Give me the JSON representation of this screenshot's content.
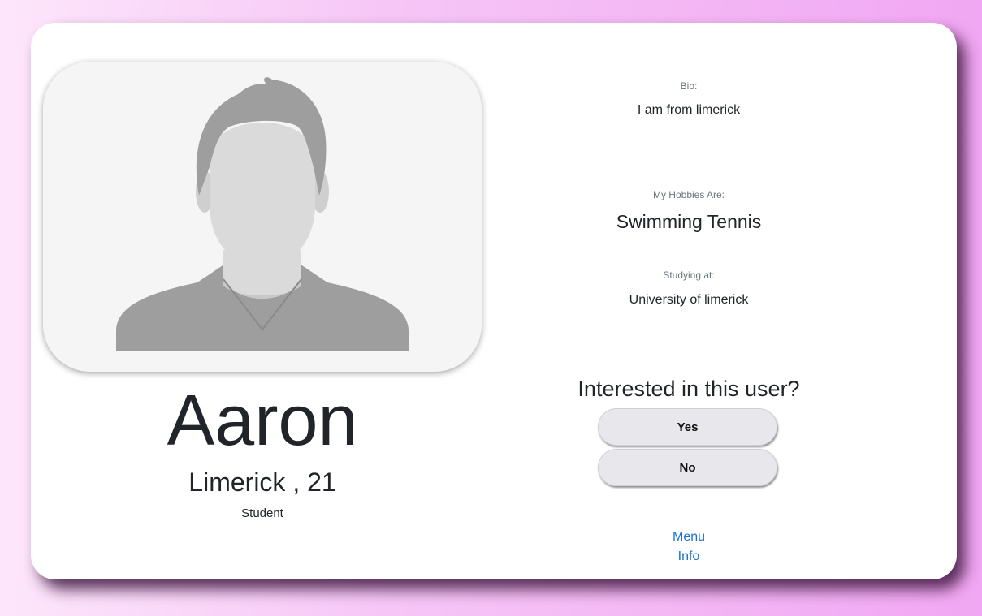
{
  "profile": {
    "name": "Aaron",
    "location_age": "Limerick , 21",
    "occupation": "Student",
    "avatar_icon": "default-user-avatar"
  },
  "details": {
    "bio_label": "Bio:",
    "bio_value": "I am from limerick",
    "hobbies_label": "My Hobbies Are:",
    "hobbies_value": "Swimming Tennis",
    "study_label": "Studying at:",
    "study_value": "University of limerick"
  },
  "interest": {
    "question": "Interested in this user?",
    "yes_label": "Yes",
    "no_label": "No"
  },
  "links": {
    "menu": "Menu",
    "info": "Info"
  },
  "colors": {
    "link": "#1a73c8",
    "button_bg": "#e8e8ec",
    "background_gradient_end": "#f1a7f3"
  }
}
